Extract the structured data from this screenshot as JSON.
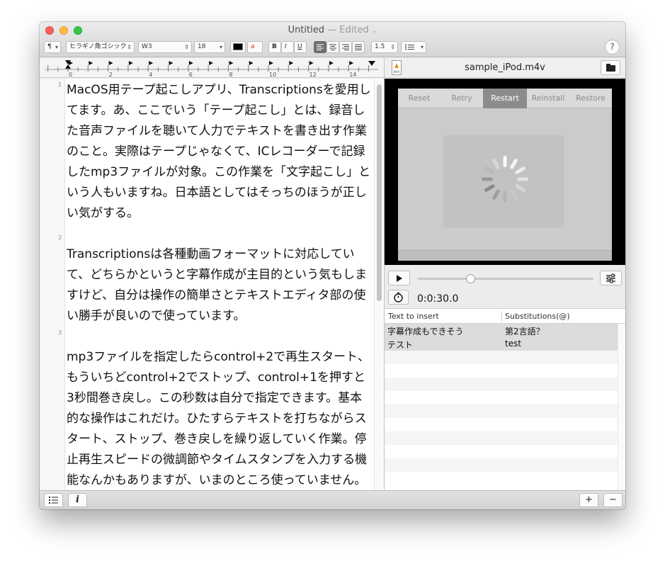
{
  "window": {
    "title": "Untitled",
    "edited": " — Edited",
    "chevron": "⌄"
  },
  "toolbar": {
    "paragraph": "¶",
    "font_family": "ヒラギノ角ゴシック",
    "font_weight": "W3",
    "font_size": "18",
    "bold": "B",
    "italic": "I",
    "underline": "U",
    "line_spacing": "1.5",
    "help": "?"
  },
  "ruler": {
    "ticks": [
      "0",
      "2",
      "4",
      "6",
      "8",
      "10",
      "12",
      "14"
    ]
  },
  "editor": {
    "line_numbers": [
      "1",
      "2",
      "3"
    ],
    "paragraphs": [
      "MacOS用テープ起こしアプリ、Transcriptionsを愛用してます。あ、ここでいう「テープ起こし」とは、録音した音声ファイルを聴いて人力でテキストを書き出す作業のこと。実際はテープじゃなくて、ICレコーダーで記録したmp3ファイルが対象。この作業を「文字起こし」という人もいますね。日本語としてはそっちのほうが正しい気がする。",
      "Transcriptionsは各種動画フォーマットに対応していて、どちらかというと字幕作成が主目的という気もしますけど、自分は操作の簡単さとテキストエディタ部の使い勝手が良いので使っています。",
      "mp3ファイルを指定したらcontrol+2で再生スタート、もういちどcontrol+2でストップ、control+1を押すと3秒間巻き戻し。この秒数は自分で指定できます。基本的な操作はこれだけ。ひたすらテキストを打ちながらスタート、ストップ、巻き戻しを繰り返していく作業。停止再生スピードの微調節やタイムスタンプを入力する機能なんかもありますが、いまのところ使っていません。"
    ]
  },
  "media": {
    "filename": "sample_iPod.m4v",
    "file_badge": "M4V",
    "video_tabs": [
      "Reset",
      "Retry",
      "Restart",
      "Reinstall",
      "Restore"
    ],
    "active_tab": "Restart",
    "play_position": 0.3,
    "timecode": "0:0:30.0"
  },
  "substitutions": {
    "columns": [
      "Text to insert",
      "Substitutions(@)"
    ],
    "rows": [
      {
        "text": "字幕作成もできそう",
        "sub": "第2言語？"
      },
      {
        "text": "テスト",
        "sub": "test"
      }
    ]
  },
  "bottom": {
    "add": "+",
    "remove": "−"
  },
  "colors": {
    "close": "#fc605c",
    "minimize": "#fdbc40",
    "maximize": "#34c84a",
    "active_tab_bg": "#8c8c8c",
    "file_icon_accent": "#f08a1b"
  }
}
